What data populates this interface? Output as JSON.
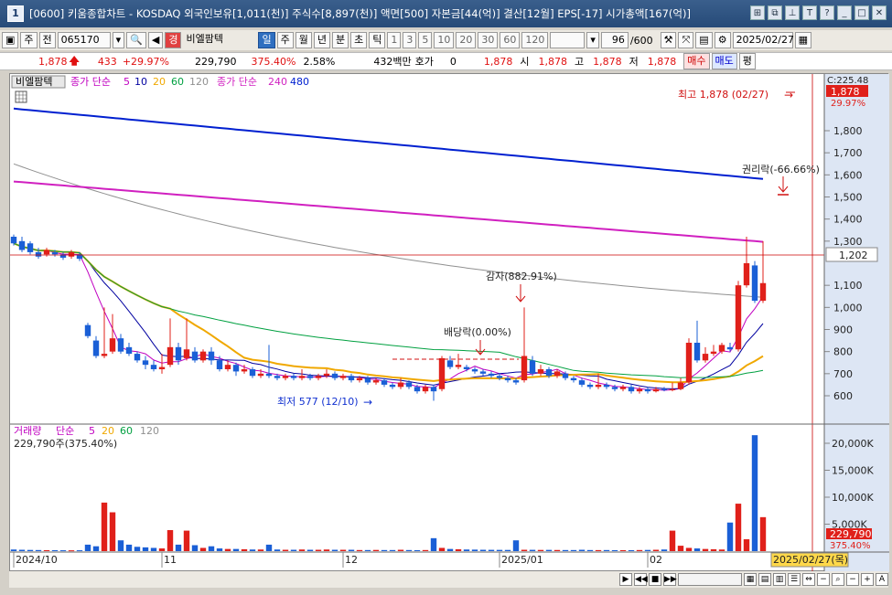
{
  "window": {
    "badge": "1",
    "title": "[0600] 키움종합차트 - KOSDAQ 외국인보유[1,011(천)] 주식수[8,897(천)] 액면[500] 자본금[44(억)] 결산[12월] EPS[-17] 시가총액[167(억)]"
  },
  "toolbar": {
    "period": "주",
    "all_label": "전",
    "code": "065170",
    "stock_tag": "경",
    "stock_name": "비엘팜텍",
    "intervals": [
      "일",
      "주",
      "월",
      "년",
      "분",
      "초",
      "틱"
    ],
    "minute_values": [
      "1",
      "3",
      "5",
      "10",
      "20",
      "30",
      "60",
      "120"
    ],
    "count": "96",
    "count_total": "/600",
    "date": "2025/02/27"
  },
  "quote": {
    "price": "1,878",
    "change": "433",
    "change_pct": "+29.97%",
    "volume": "229,790",
    "volume_ratio": "375.40%",
    "turnover": "2.58%",
    "amount": "432백만",
    "hoga_label": "호가",
    "hoga_value": "0",
    "hoga_price": "1,878",
    "open_label": "시",
    "open": "1,878",
    "high_label": "고",
    "high": "1,878",
    "low_label": "저",
    "low": "1,878",
    "buy_label": "매수",
    "sell_label": "매도",
    "eval_label": "평"
  },
  "legend_top": {
    "name": "비엘팜텍",
    "ma_label": "종가 단순",
    "ma_periods": [
      "5",
      "10",
      "20",
      "60",
      "120"
    ],
    "ma_label2": "종가 단순",
    "ma_periods2": [
      "240",
      "480"
    ]
  },
  "legend_bottom": {
    "name": "거래량",
    "ma_label": "단순",
    "ma_periods": [
      "5",
      "20",
      "60",
      "120"
    ],
    "summary": "229,790주(375.40%)"
  },
  "annotations": {
    "high": "최고 1,878 (02/27)",
    "low": "최저 577 (12/10)",
    "rights": "권리락(-66.66%)",
    "capital_reduction": "감자(882.91%)",
    "dividend": "배당락(0.00%)"
  },
  "price_axis": {
    "top_label": "C:225.48",
    "current": "1,878",
    "current_pct": "29.97%",
    "crosshair": "1,202",
    "ticks": [
      "1,800",
      "1,700",
      "1,600",
      "1,500",
      "1,400",
      "1,300",
      "1,100",
      "1,000",
      "900",
      "800",
      "700",
      "600"
    ]
  },
  "volume_axis": {
    "ticks": [
      "20,000K",
      "15,000K",
      "10,000K",
      "5,000K"
    ],
    "current": "229,790",
    "current_pct": "375.40%"
  },
  "x_axis": {
    "labels": [
      "2024/10",
      "11",
      "12",
      "2025/01",
      "02"
    ],
    "current_date": "2025/02/27(목)"
  },
  "colors": {
    "up": "#e0201a",
    "down": "#1a5fd6",
    "ma5": "#c000c0",
    "ma10": "#0000a0",
    "ma20": "#f0a800",
    "ma60": "#00a040",
    "ma120": "#909090",
    "ma240": "#d020c0",
    "ma480": "#0020d0"
  },
  "chart_data": {
    "type": "candlestick",
    "price_range": [
      550,
      1850
    ],
    "candles": [
      {
        "o": 1320,
        "c": 1290,
        "h": 1330,
        "l": 1280
      },
      {
        "o": 1300,
        "c": 1260,
        "h": 1320,
        "l": 1250
      },
      {
        "o": 1290,
        "c": 1250,
        "h": 1300,
        "l": 1240
      },
      {
        "o": 1250,
        "c": 1230,
        "h": 1270,
        "l": 1220
      },
      {
        "o": 1240,
        "c": 1260,
        "h": 1270,
        "l": 1230
      },
      {
        "o": 1250,
        "c": 1240,
        "h": 1260,
        "l": 1230
      },
      {
        "o": 1240,
        "c": 1225,
        "h": 1250,
        "l": 1215
      },
      {
        "o": 1230,
        "c": 1250,
        "h": 1260,
        "l": 1220
      },
      {
        "o": 1240,
        "c": 1220,
        "h": 1250,
        "l": 1210
      },
      {
        "o": 920,
        "c": 870,
        "h": 930,
        "l": 860
      },
      {
        "o": 850,
        "c": 780,
        "h": 870,
        "l": 770
      },
      {
        "o": 780,
        "c": 790,
        "h": 1000,
        "l": 770
      },
      {
        "o": 800,
        "c": 860,
        "h": 970,
        "l": 790
      },
      {
        "o": 860,
        "c": 800,
        "h": 880,
        "l": 790
      },
      {
        "o": 820,
        "c": 790,
        "h": 840,
        "l": 780
      },
      {
        "o": 790,
        "c": 760,
        "h": 800,
        "l": 750
      },
      {
        "o": 760,
        "c": 740,
        "h": 780,
        "l": 720
      },
      {
        "o": 740,
        "c": 720,
        "h": 760,
        "l": 710
      },
      {
        "o": 720,
        "c": 730,
        "h": 790,
        "l": 700
      },
      {
        "o": 740,
        "c": 820,
        "h": 950,
        "l": 730
      },
      {
        "o": 820,
        "c": 760,
        "h": 840,
        "l": 740
      },
      {
        "o": 770,
        "c": 810,
        "h": 950,
        "l": 760
      },
      {
        "o": 800,
        "c": 760,
        "h": 820,
        "l": 750
      },
      {
        "o": 760,
        "c": 800,
        "h": 810,
        "l": 750
      },
      {
        "o": 800,
        "c": 760,
        "h": 820,
        "l": 740
      },
      {
        "o": 760,
        "c": 720,
        "h": 780,
        "l": 710
      },
      {
        "o": 720,
        "c": 740,
        "h": 760,
        "l": 710
      },
      {
        "o": 740,
        "c": 710,
        "h": 750,
        "l": 690
      },
      {
        "o": 710,
        "c": 720,
        "h": 740,
        "l": 700
      },
      {
        "o": 720,
        "c": 690,
        "h": 730,
        "l": 680
      },
      {
        "o": 690,
        "c": 700,
        "h": 720,
        "l": 680
      },
      {
        "o": 700,
        "c": 690,
        "h": 830,
        "l": 680
      },
      {
        "o": 690,
        "c": 680,
        "h": 700,
        "l": 670
      },
      {
        "o": 680,
        "c": 690,
        "h": 700,
        "l": 670
      },
      {
        "o": 690,
        "c": 680,
        "h": 700,
        "l": 670
      },
      {
        "o": 680,
        "c": 690,
        "h": 720,
        "l": 670
      },
      {
        "o": 690,
        "c": 680,
        "h": 700,
        "l": 670
      },
      {
        "o": 680,
        "c": 690,
        "h": 700,
        "l": 670
      },
      {
        "o": 690,
        "c": 700,
        "h": 720,
        "l": 680
      },
      {
        "o": 700,
        "c": 680,
        "h": 710,
        "l": 670
      },
      {
        "o": 680,
        "c": 690,
        "h": 700,
        "l": 670
      },
      {
        "o": 690,
        "c": 670,
        "h": 700,
        "l": 660
      },
      {
        "o": 670,
        "c": 680,
        "h": 690,
        "l": 660
      },
      {
        "o": 680,
        "c": 660,
        "h": 690,
        "l": 650
      },
      {
        "o": 660,
        "c": 670,
        "h": 680,
        "l": 650
      },
      {
        "o": 670,
        "c": 650,
        "h": 680,
        "l": 640
      },
      {
        "o": 650,
        "c": 640,
        "h": 660,
        "l": 630
      },
      {
        "o": 640,
        "c": 660,
        "h": 680,
        "l": 630
      },
      {
        "o": 660,
        "c": 640,
        "h": 670,
        "l": 630
      },
      {
        "o": 640,
        "c": 620,
        "h": 650,
        "l": 610
      },
      {
        "o": 620,
        "c": 640,
        "h": 650,
        "l": 610
      },
      {
        "o": 640,
        "c": 620,
        "h": 650,
        "l": 577
      },
      {
        "o": 630,
        "c": 770,
        "h": 780,
        "l": 620
      },
      {
        "o": 760,
        "c": 730,
        "h": 780,
        "l": 720
      },
      {
        "o": 730,
        "c": 740,
        "h": 790,
        "l": 720
      },
      {
        "o": 730,
        "c": 720,
        "h": 740,
        "l": 710
      },
      {
        "o": 720,
        "c": 710,
        "h": 730,
        "l": 700
      },
      {
        "o": 710,
        "c": 700,
        "h": 720,
        "l": 690
      },
      {
        "o": 700,
        "c": 690,
        "h": 710,
        "l": 680
      },
      {
        "o": 690,
        "c": 680,
        "h": 700,
        "l": 670
      },
      {
        "o": 680,
        "c": 670,
        "h": 690,
        "l": 660
      },
      {
        "o": 670,
        "c": 660,
        "h": 680,
        "l": 650
      },
      {
        "o": 670,
        "c": 780,
        "h": 1000,
        "l": 660
      },
      {
        "o": 760,
        "c": 700,
        "h": 780,
        "l": 690
      },
      {
        "o": 700,
        "c": 720,
        "h": 740,
        "l": 690
      },
      {
        "o": 720,
        "c": 690,
        "h": 730,
        "l": 680
      },
      {
        "o": 690,
        "c": 710,
        "h": 720,
        "l": 680
      },
      {
        "o": 700,
        "c": 680,
        "h": 710,
        "l": 670
      },
      {
        "o": 680,
        "c": 670,
        "h": 690,
        "l": 660
      },
      {
        "o": 670,
        "c": 650,
        "h": 680,
        "l": 640
      },
      {
        "o": 650,
        "c": 640,
        "h": 660,
        "l": 630
      },
      {
        "o": 640,
        "c": 650,
        "h": 700,
        "l": 630
      },
      {
        "o": 650,
        "c": 640,
        "h": 660,
        "l": 630
      },
      {
        "o": 640,
        "c": 630,
        "h": 650,
        "l": 620
      },
      {
        "o": 630,
        "c": 640,
        "h": 650,
        "l": 620
      },
      {
        "o": 640,
        "c": 620,
        "h": 650,
        "l": 610
      },
      {
        "o": 620,
        "c": 630,
        "h": 640,
        "l": 610
      },
      {
        "o": 630,
        "c": 620,
        "h": 640,
        "l": 610
      },
      {
        "o": 620,
        "c": 630,
        "h": 640,
        "l": 615
      },
      {
        "o": 630,
        "c": 625,
        "h": 640,
        "l": 620
      },
      {
        "o": 625,
        "c": 630,
        "h": 660,
        "l": 620
      },
      {
        "o": 630,
        "c": 660,
        "h": 680,
        "l": 625
      },
      {
        "o": 660,
        "c": 840,
        "h": 860,
        "l": 650
      },
      {
        "o": 840,
        "c": 760,
        "h": 940,
        "l": 750
      },
      {
        "o": 760,
        "c": 790,
        "h": 820,
        "l": 750
      },
      {
        "o": 790,
        "c": 800,
        "h": 830,
        "l": 780
      },
      {
        "o": 800,
        "c": 830,
        "h": 840,
        "l": 790
      },
      {
        "o": 820,
        "c": 810,
        "h": 840,
        "l": 800
      },
      {
        "o": 810,
        "c": 1100,
        "h": 1120,
        "l": 800
      },
      {
        "o": 1100,
        "c": 1200,
        "h": 1320,
        "l": 1090
      },
      {
        "o": 1190,
        "c": 1030,
        "h": 1210,
        "l": 1020
      },
      {
        "o": 1030,
        "c": 1110,
        "h": 1300,
        "l": 1020
      }
    ],
    "volume_max_k": 22000,
    "volumes_k": [
      300,
      250,
      220,
      200,
      180,
      170,
      160,
      150,
      160,
      1200,
      900,
      9000,
      7200,
      2000,
      1200,
      800,
      700,
      600,
      500,
      3900,
      1200,
      3800,
      1100,
      600,
      900,
      500,
      400,
      400,
      350,
      300,
      300,
      1200,
      300,
      250,
      250,
      300,
      250,
      250,
      300,
      250,
      250,
      250,
      200,
      200,
      220,
      200,
      200,
      250,
      200,
      180,
      200,
      2400,
      600,
      400,
      350,
      300,
      280,
      250,
      240,
      230,
      220,
      2000,
      250,
      240,
      220,
      230,
      210,
      200,
      200,
      250,
      200,
      190,
      200,
      180,
      180,
      180,
      200,
      220,
      250,
      300,
      3800,
      1000,
      600,
      500,
      400,
      350,
      300,
      5300,
      8800,
      2200,
      21500,
      6300
    ]
  }
}
